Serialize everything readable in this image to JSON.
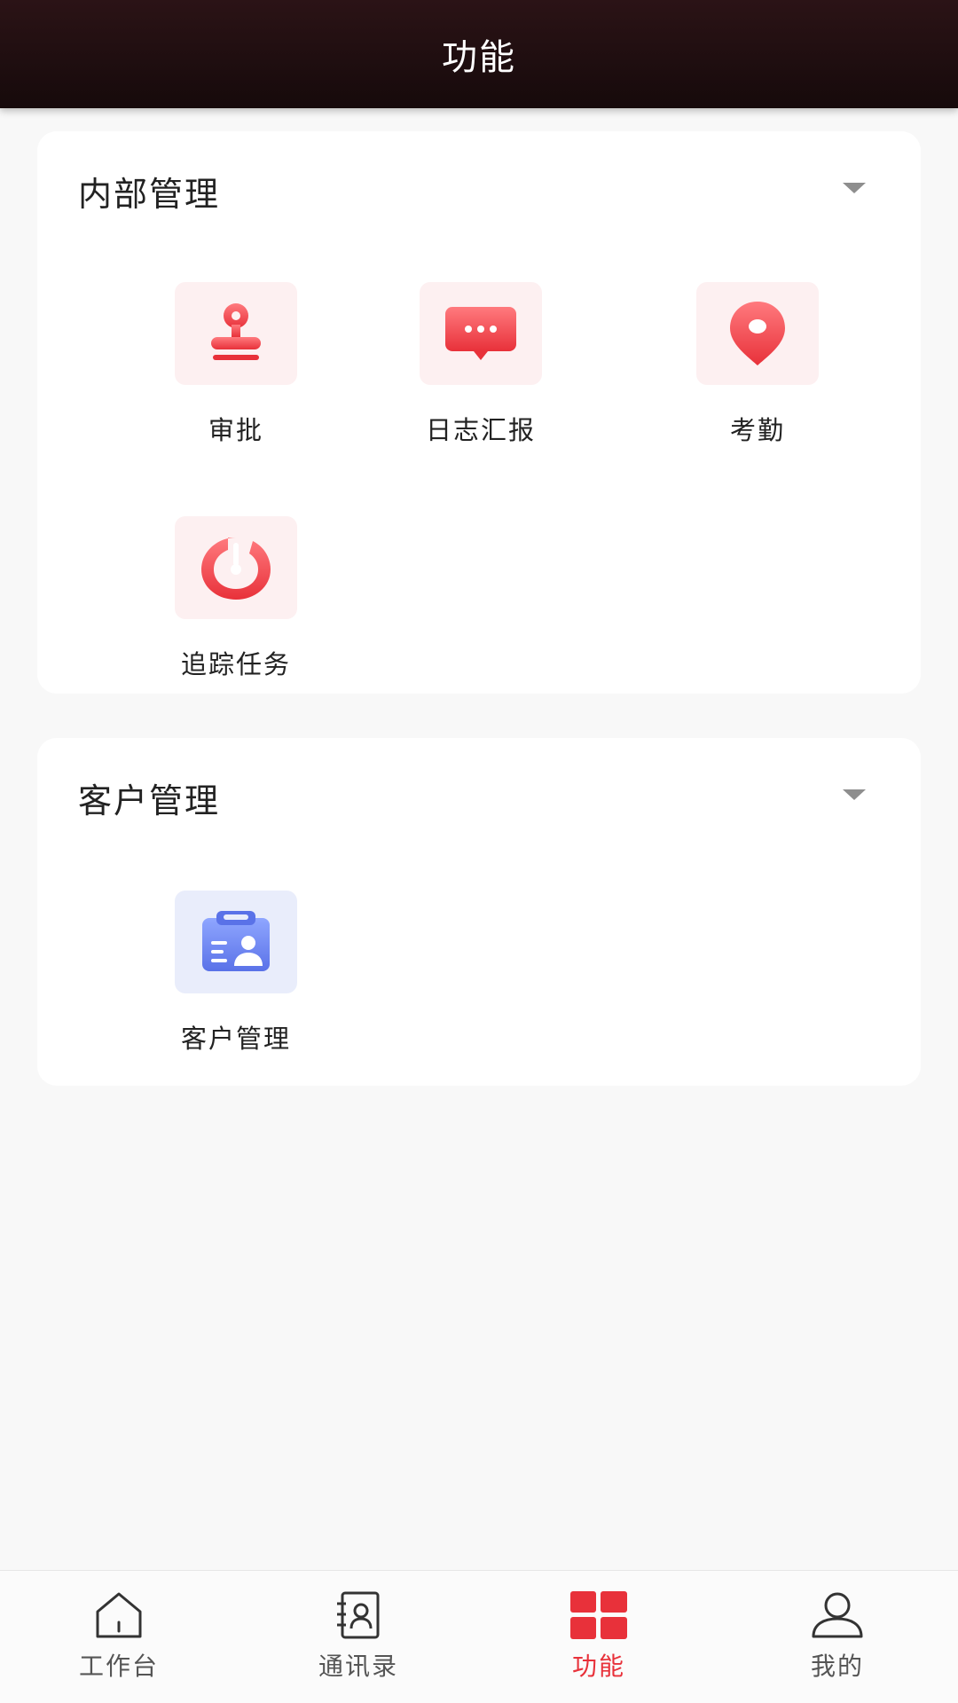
{
  "header": {
    "title": "功能"
  },
  "sections": {
    "internal": {
      "title": "内部管理",
      "items": [
        "审批",
        "日志汇报",
        "考勤",
        "追踪任务"
      ]
    },
    "customer": {
      "title": "客户管理",
      "items": [
        "客户管理"
      ]
    }
  },
  "bottom_nav": {
    "items": [
      "工作台",
      "通讯录",
      "功能",
      "我的"
    ],
    "active": "功能"
  },
  "colors": {
    "accent": "#e8313a",
    "header_bg": "#1c0d0f",
    "icon_tile_red": "#fdf0f1",
    "icon_tile_blue": "#e9edfb"
  },
  "icons": {
    "approval": "stamp-icon",
    "log_report": "message-bubble-icon",
    "attendance": "location-pin-icon",
    "tracking": "target-icon",
    "customer": "contact-card-icon"
  }
}
